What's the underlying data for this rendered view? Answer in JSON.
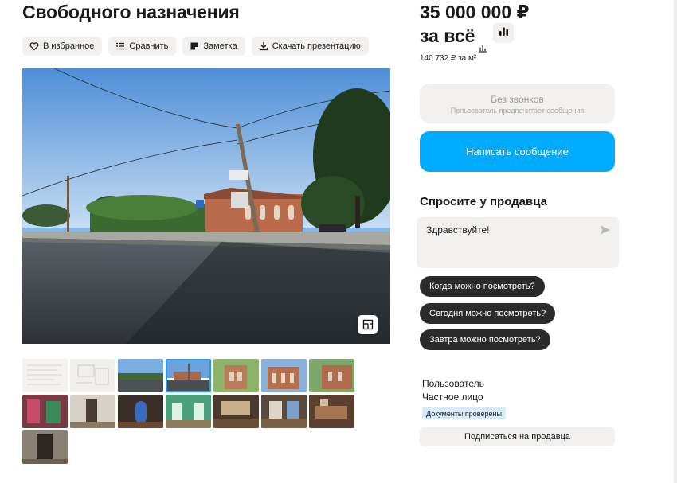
{
  "listing": {
    "title": "Свободного назначения"
  },
  "actions": {
    "favorite": {
      "label": "В избранное",
      "icon": "heart-icon"
    },
    "compare": {
      "label": "Сравнить",
      "icon": "compare-icon"
    },
    "note": {
      "label": "Заметка",
      "icon": "note-icon"
    },
    "download": {
      "label": "Скачать презентацию",
      "icon": "download-icon"
    }
  },
  "gallery": {
    "plan_icon": "floor-plan-icon",
    "selected_index": 3,
    "thumb_count": 15
  },
  "price": {
    "amount": "35 000 000 ₽",
    "unit": "за всё",
    "per_sqm": "140 732 ₽ за м²",
    "stats_icon": "bar-chart-icon"
  },
  "contact": {
    "no_calls_title": "Без звонков",
    "no_calls_subtitle": "Пользователь предпочитает сообщения",
    "write_button": "Написать сообщение"
  },
  "ask": {
    "title": "Спросите у продавца",
    "message_value": "Здравствуйте!",
    "quick_questions": [
      "Когда можно посмотреть?",
      "Сегодня можно посмотреть?",
      "Завтра можно посмотреть?"
    ]
  },
  "seller": {
    "name": "Пользователь",
    "type": "Частное лицо",
    "badge": "Документы проверены",
    "subscribe": "Подписаться на продавца"
  },
  "colors": {
    "accent": "#00aaff",
    "chip_dark": "#2b2b2b",
    "button_bg": "#f2f1f0",
    "badge_bg": "#d6ecfb"
  }
}
